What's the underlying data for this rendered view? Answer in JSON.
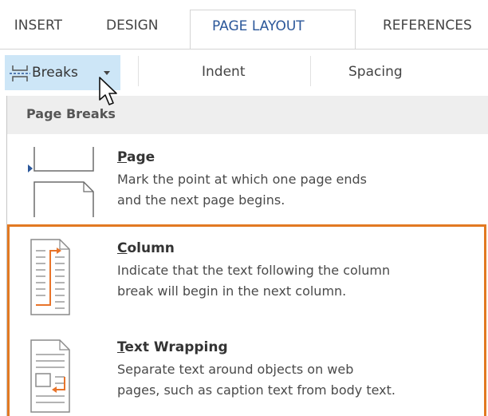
{
  "ribbon_tabs": {
    "insert": "INSERT",
    "design": "DESIGN",
    "page_layout": "PAGE LAYOUT",
    "references": "REFERENCES"
  },
  "ribbon": {
    "breaks_label": "Breaks",
    "indent_label": "Indent",
    "spacing_label": "Spacing"
  },
  "breaks_menu": {
    "header": "Page Breaks",
    "items": [
      {
        "accel": "P",
        "title_rest": "age",
        "desc_line1": "Mark the point at which one page ends",
        "desc_line2": "and the next page begins.",
        "icon": "page-break-icon"
      },
      {
        "accel": "C",
        "title_rest": "olumn",
        "desc_line1": "Indicate that the text following the column",
        "desc_line2": "break will begin in the next column.",
        "icon": "column-break-icon"
      },
      {
        "accel": "T",
        "title_rest": "ext Wrapping",
        "desc_line1": "Separate text around objects on web",
        "desc_line2": "pages, such as caption text from body text.",
        "icon": "text-wrapping-icon"
      }
    ]
  },
  "colors": {
    "active_tab_text": "#2b579a",
    "breaks_button_hover": "#cde6f7",
    "highlight_border": "#e27922",
    "icon_accent": "#e8742a",
    "page_marker": "#2b579a"
  }
}
